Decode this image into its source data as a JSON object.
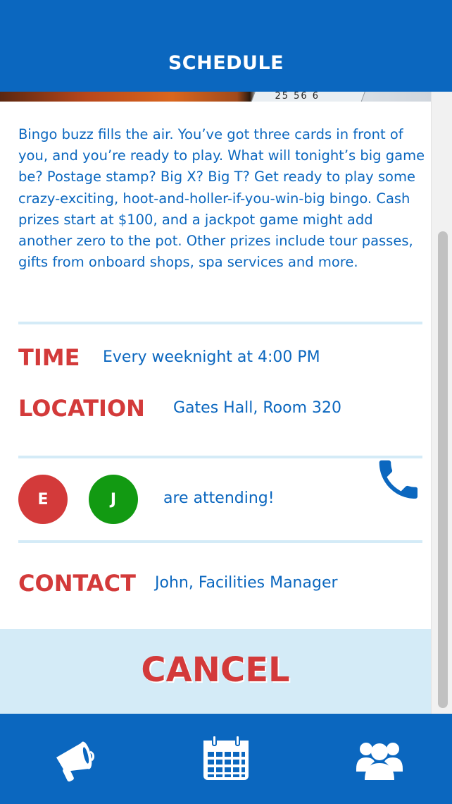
{
  "header": {
    "title": "SCHEDULE"
  },
  "event": {
    "hero_card_text": "25  56 6",
    "description": "Bingo buzz fills the air. You’ve got three cards in front of you, and you’re ready to play. What will tonight’s big game be? Postage stamp? Big X? Big T? Get ready to play some crazy-exciting, hoot-and-holler-if-you-win-big bingo. Cash prizes start at $100, and a jackpot game might add another zero to the pot. Other prizes include tour passes, gifts from onboard shops, spa services and more.",
    "time_label": "TIME",
    "time_value": "Every weeknight at 4:00 PM",
    "location_label": "LOCATION",
    "location_value": "Gates Hall, Room 320"
  },
  "attendees": {
    "people": [
      {
        "initial": "E",
        "color": "#d33a3a"
      },
      {
        "initial": "J",
        "color": "#129a12"
      }
    ],
    "text": "are attending!"
  },
  "contact": {
    "label": "CONTACT",
    "value": "John, Facilities Manager",
    "icon": "phone-icon"
  },
  "actions": {
    "cancel_label": "CANCEL"
  },
  "nav": {
    "items": [
      {
        "icon": "megaphone-icon"
      },
      {
        "icon": "calendar-icon"
      },
      {
        "icon": "group-icon"
      }
    ]
  },
  "colors": {
    "primary": "#0b67bf",
    "accent": "#d33a3a",
    "light": "#d4ebf7"
  }
}
